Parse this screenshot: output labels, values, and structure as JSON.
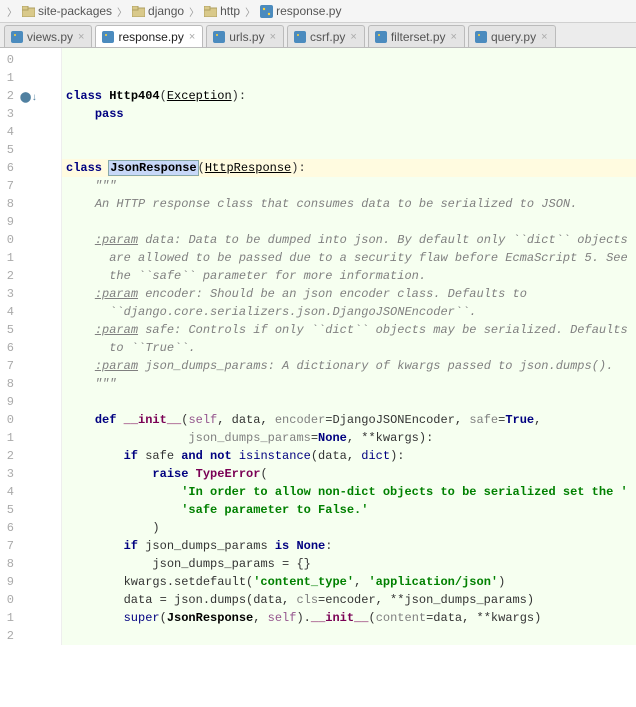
{
  "breadcrumb": [
    {
      "type": "folder",
      "label": "site-packages"
    },
    {
      "type": "folder",
      "label": "django"
    },
    {
      "type": "folder",
      "label": "http"
    },
    {
      "type": "py",
      "label": "response.py"
    }
  ],
  "tabs": [
    {
      "label": "views.py",
      "active": false
    },
    {
      "label": "response.py",
      "active": true
    },
    {
      "label": "urls.py",
      "active": false
    },
    {
      "label": "csrf.py",
      "active": false
    },
    {
      "label": "filterset.py",
      "active": false
    },
    {
      "label": "query.py",
      "active": false
    }
  ],
  "line_numbers": [
    "0",
    "1",
    "2",
    "3",
    "4",
    "5",
    "6",
    "7",
    "8",
    "9",
    "0",
    "1",
    "2",
    "3",
    "4",
    "5",
    "6",
    "7",
    "8",
    "9",
    "0",
    "1",
    "2",
    "3",
    "4",
    "5",
    "6",
    "7",
    "8",
    "9",
    "0",
    "1",
    "2"
  ],
  "code": {
    "l2_class": "class ",
    "l2_name": "Http404",
    "l2_open": "(",
    "l2_base": "Exception",
    "l2_close": "):",
    "l3_pass": "pass",
    "l6_class": "class ",
    "l6_name": "JsonResponse",
    "l6_open": "(",
    "l6_base": "HttpResponse",
    "l6_close": "):",
    "l7_doc": "\"\"\"",
    "l8_doc": "An HTTP response class that consumes data to be serialized to JSON.",
    "l10_p": ":param",
    "l10_t": " data: Data to be dumped into json. By default only ``dict`` objects",
    "l11_t": "  are allowed to be passed due to a security flaw before EcmaScript 5. See",
    "l12_t": "  the ``safe`` parameter for more information.",
    "l13_p": ":param",
    "l13_t": " encoder: Should be an json encoder class. Defaults to",
    "l14_t": "  ``django.core.serializers.json.DjangoJSONEncoder``.",
    "l15_p": ":param",
    "l15_t": " safe: Controls if only ``dict`` objects may be serialized. Defaults",
    "l16_t": "  to ``True``.",
    "l17_p": ":param",
    "l17_t": " json_dumps_params: A dictionary of kwargs passed to json.dumps().",
    "l18_doc": "\"\"\"",
    "l20_def": "def ",
    "l20_fn": "__init__",
    "l20_open": "(",
    "l20_self": "self",
    "l20_c1": ", data, ",
    "l20_enc": "encoder",
    "l20_eq": "=DjangoJSONEncoder, ",
    "l20_safe": "safe",
    "l20_eq2": "=",
    "l20_true": "True",
    "l20_c2": ",",
    "l21_jdp": "json_dumps_params",
    "l21_eq": "=",
    "l21_none": "None",
    "l21_c": ", **kwargs):",
    "l22_if": "if ",
    "l22_t1": "safe ",
    "l22_and": "and not ",
    "l22_isi": "isinstance",
    "l22_t2": "(data, ",
    "l22_dict": "dict",
    "l22_t3": "):",
    "l23_raise": "raise ",
    "l23_te": "TypeError",
    "l23_open": "(",
    "l24_str": "'In order to allow non-dict objects to be serialized set the '",
    "l25_str": "'safe parameter to False.'",
    "l26_close": ")",
    "l27_if": "if ",
    "l27_t1": "json_dumps_params ",
    "l27_is": "is ",
    "l27_none": "None",
    "l27_c": ":",
    "l28_t": "json_dumps_params = {}",
    "l29_t1": "kwargs.setdefault(",
    "l29_s1": "'content_type'",
    "l29_t2": ", ",
    "l29_s2": "'application/json'",
    "l29_t3": ")",
    "l30_t1": "data = json.dumps(data, ",
    "l30_cls": "cls",
    "l30_t2": "=encoder, **json_dumps_params)",
    "l31_super": "super",
    "l31_open": "(",
    "l31_jr": "JsonResponse",
    "l31_t1": ", ",
    "l31_self": "self",
    "l31_t2": ").",
    "l31_init": "__init__",
    "l31_t3": "(",
    "l31_content": "content",
    "l31_t4": "=data, **kwargs)"
  }
}
